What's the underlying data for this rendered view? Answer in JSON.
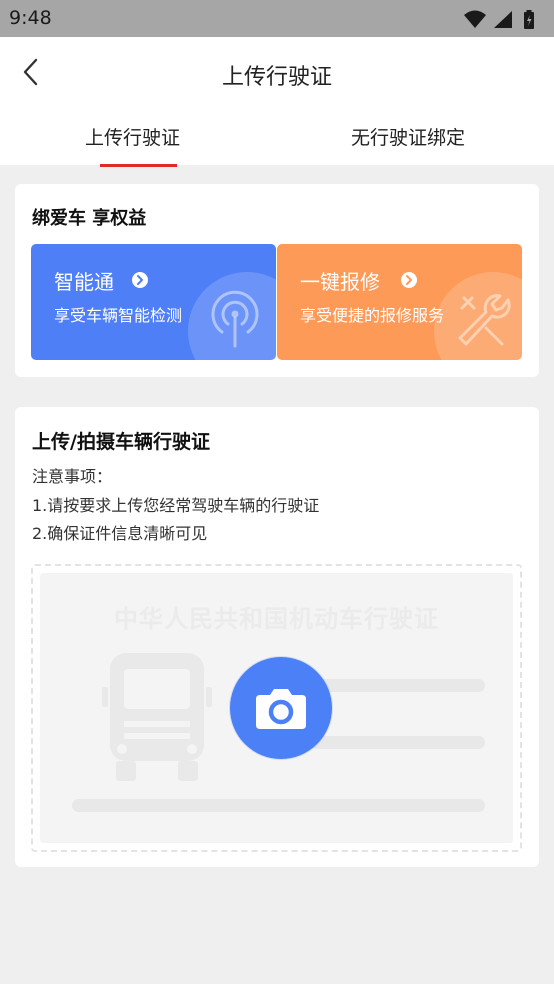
{
  "status_bar": {
    "time": "9:48",
    "icons": [
      "wifi-icon",
      "signal-icon",
      "battery-icon"
    ]
  },
  "header": {
    "title": "上传行驶证",
    "back_icon": "chevron-left-icon",
    "tabs": [
      {
        "label": "上传行驶证",
        "active": true
      },
      {
        "label": "无行驶证绑定",
        "active": false
      }
    ],
    "active_tab_color": "#e02a28"
  },
  "bind_card": {
    "title": "绑爱车 享权益",
    "services": [
      {
        "name": "智能通",
        "subtitle": "享受车辆智能检测",
        "color": "#4f7ff7",
        "icon": "signal-tower-icon"
      },
      {
        "name": "一键报修",
        "subtitle": "享受便捷的报修服务",
        "color": "#fd9a58",
        "icon": "wrench-icon"
      }
    ]
  },
  "upload_card": {
    "title": "上传/拍摄车辆行驶证",
    "notes": [
      "注意事项：",
      "1.请按要求上传您经常驾驶车辆的行驶证",
      "2.确保证件信息清晰可见"
    ],
    "license_placeholder_title": "中华人民共和国机动车行驶证",
    "camera_icon": "camera-icon",
    "camera_color": "#4c80f6"
  }
}
